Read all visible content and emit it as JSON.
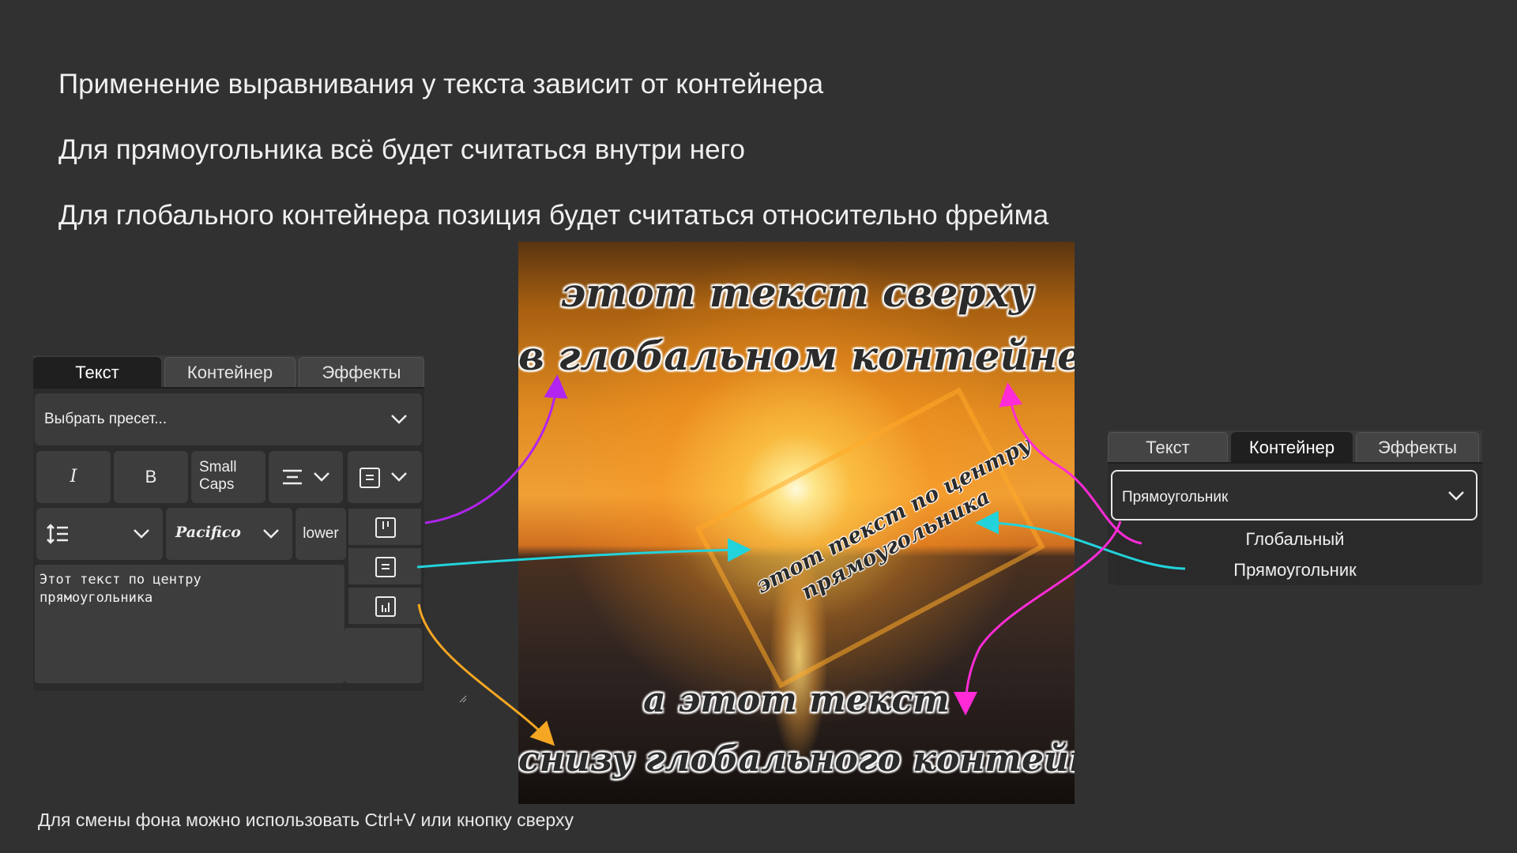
{
  "headings": [
    "Применение выравнивания у текста зависит от контейнера",
    "Для прямоугольника всё будет считаться внутри него",
    "Для глобального контейнера позиция будет считаться относительно  фрейма"
  ],
  "footer": "Для смены фона можно использовать Ctrl+V или кнопку сверху",
  "left_panel": {
    "tabs": [
      "Текст",
      "Контейнер",
      "Эффекты"
    ],
    "active_tab": "Текст",
    "preset_placeholder": "Выбрать пресет...",
    "italic_label": "I",
    "bold_label": "B",
    "small_caps_label": "Small\nCaps",
    "font_name": "Pacifico",
    "case_label": "lower",
    "text_lines": [
      "Этот текст по центру",
      "прямоугольника"
    ]
  },
  "image_overlay": {
    "top_line1": "этот текст сверху",
    "top_line2": "в глобальном контейнере",
    "center_line1": "этот текст по центру",
    "center_line2": "прямоугольника",
    "bottom_line1": "а этот текст",
    "bottom_line2": "снизу глобального контейнера"
  },
  "right_panel": {
    "tabs": [
      "Текст",
      "Контейнер",
      "Эффекты"
    ],
    "active_tab": "Контейнер",
    "selected": "Прямоугольник",
    "options": [
      "Глобальный",
      "Прямоугольник"
    ]
  },
  "colors": {
    "background": "#313131",
    "arrow_purple": "#b224f0",
    "arrow_cyan": "#22d3dc",
    "arrow_orange": "#f5a623",
    "arrow_magenta": "#ff2bd6"
  }
}
